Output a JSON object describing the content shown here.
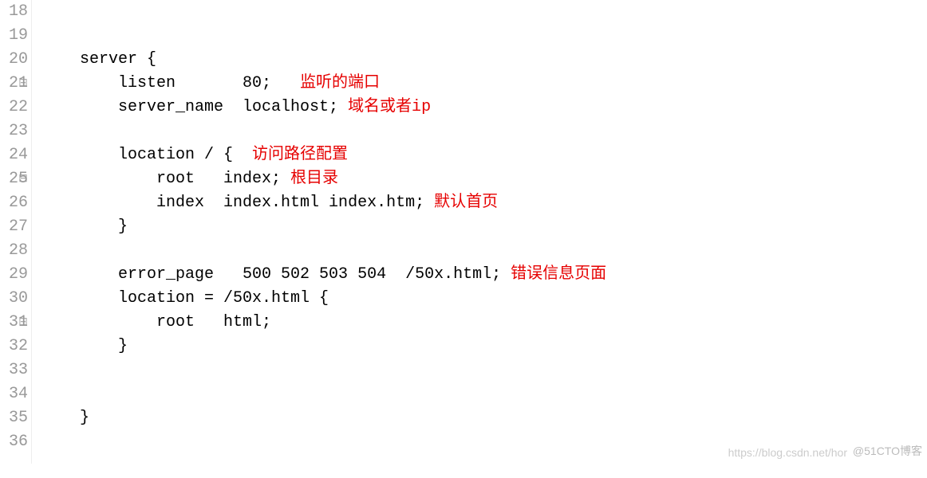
{
  "lines": [
    {
      "num": "18",
      "fold": "",
      "code": "",
      "comment": ""
    },
    {
      "num": "19",
      "fold": "",
      "code": "",
      "comment": ""
    },
    {
      "num": "20",
      "fold": "⊟",
      "code": "    server {",
      "comment": ""
    },
    {
      "num": "21",
      "fold": "",
      "code": "        listen       80;   ",
      "comment": "监听的端口"
    },
    {
      "num": "22",
      "fold": "",
      "code": "        server_name  localhost; ",
      "comment": "域名或者ip"
    },
    {
      "num": "23",
      "fold": "",
      "code": "",
      "comment": ""
    },
    {
      "num": "24",
      "fold": "⊟",
      "code": "        location / {  ",
      "comment": "访问路径配置"
    },
    {
      "num": "25",
      "fold": "",
      "code": "            root   index; ",
      "comment": "根目录"
    },
    {
      "num": "26",
      "fold": "",
      "code": "            index  index.html index.htm; ",
      "comment": "默认首页"
    },
    {
      "num": "27",
      "fold": "",
      "code": "        }",
      "comment": ""
    },
    {
      "num": "28",
      "fold": "",
      "code": "",
      "comment": ""
    },
    {
      "num": "29",
      "fold": "",
      "code": "        error_page   500 502 503 504  /50x.html; ",
      "comment": "错误信息页面"
    },
    {
      "num": "30",
      "fold": "⊟",
      "code": "        location = /50x.html {",
      "comment": ""
    },
    {
      "num": "31",
      "fold": "",
      "code": "            root   html;",
      "comment": ""
    },
    {
      "num": "32",
      "fold": "",
      "code": "        }",
      "comment": ""
    },
    {
      "num": "33",
      "fold": "",
      "code": "",
      "comment": ""
    },
    {
      "num": "34",
      "fold": "",
      "code": "",
      "comment": ""
    },
    {
      "num": "35",
      "fold": "",
      "code": "    }",
      "comment": ""
    },
    {
      "num": "36",
      "fold": "",
      "code": "",
      "comment": ""
    }
  ],
  "watermark_faint": "https://blog.csdn.net/hor",
  "watermark_brand": "@51CTO博客"
}
